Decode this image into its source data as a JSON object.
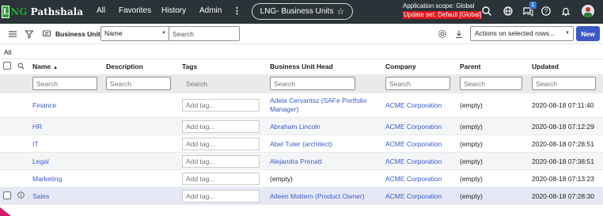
{
  "topbar": {
    "logo_mark": "L",
    "logo_lng": "NG",
    "logo_rest": " Pathshala",
    "nav": [
      "All",
      "Favorites",
      "History",
      "Admin"
    ],
    "more": "⋮",
    "page_title": "LNG- Business Units",
    "scope_line": "Application scope: Global",
    "update_set": "Update set: Default [Global]",
    "notification_count": "1",
    "colors": {
      "bar": "#2a3338",
      "update_set_bg": "#e0161c",
      "logo_green": "#2f9e3a"
    }
  },
  "toolbar": {
    "list_title": "Business Units",
    "search_field": "Name",
    "search_placeholder": "Search",
    "actions_label": "Actions on selected rows...",
    "new_label": "New",
    "accent": "#3a59c6"
  },
  "breadcrumb": "All",
  "table": {
    "columns": [
      "Name",
      "Description",
      "Tags",
      "Business Unit Head",
      "Company",
      "Parent",
      "Updated"
    ],
    "search_placeholders": [
      "Search",
      "Search",
      "Search",
      "Search",
      "Search",
      "Search",
      "Search"
    ],
    "tag_placeholder": "Add tag...",
    "rows": [
      {
        "name": "Finance",
        "description": "",
        "head_line1": "Adela Cervantsz (SAFe Portfolio",
        "head_line2": "Manager)",
        "company": "ACME Corporation",
        "parent": "(empty)",
        "updated": "2020-08-18 07:11:40"
      },
      {
        "name": "HR",
        "description": "",
        "head": "Abraham Lincoln",
        "company": "ACME Corporation",
        "parent": "(empty)",
        "updated": "2020-08-18 07:12:29"
      },
      {
        "name": "IT",
        "description": "",
        "head": "Abel Tuter (architect)",
        "company": "ACME Corporation",
        "parent": "(empty)",
        "updated": "2020-08-18 07:28:51"
      },
      {
        "name": "Legal",
        "description": "",
        "head": "Alejandra Prenatt",
        "company": "ACME Corporation",
        "parent": "(empty)",
        "updated": "2020-08-18 07:38:51"
      },
      {
        "name": "Marketing",
        "description": "",
        "head": "(empty)",
        "company": "ACME Corporation",
        "parent": "(empty)",
        "updated": "2020-08-18 07:13:23"
      },
      {
        "name": "Sales",
        "description": "",
        "head": "Aileen Mottern (Product Owner)",
        "company": "ACME Corporation",
        "parent": "(empty)",
        "updated": "2020-08-18 07:28:30"
      }
    ]
  },
  "icons": [
    "hamburger-icon",
    "filter-icon",
    "comment-icon",
    "search-icon",
    "globe-icon",
    "chat-icon",
    "help-icon",
    "bell-icon",
    "settings-icon",
    "download-icon",
    "star-icon",
    "info-icon"
  ]
}
